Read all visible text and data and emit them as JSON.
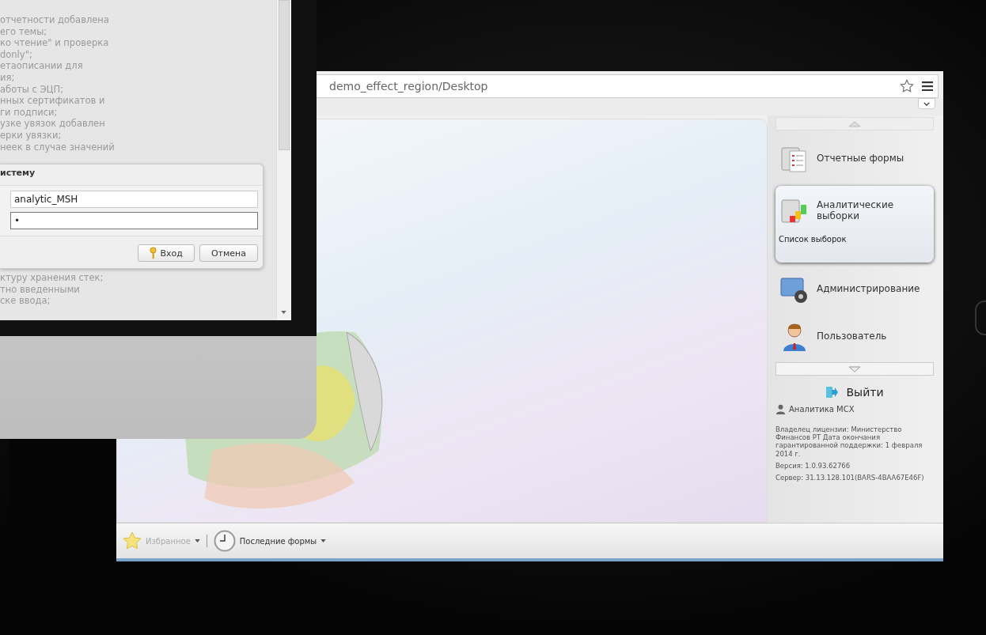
{
  "monitor": {
    "notes_before": [
      "отчетности добавлена",
      "его темы;",
      "ко чтение\" и проверка",
      "donly\";",
      "етаописании для",
      "ия;",
      "аботы с ЭЦП;",
      "нных сертификатов и",
      "ги подписи;",
      "узке увязок добавлен",
      "ерки увязки;",
      "неек в случае значений"
    ],
    "login": {
      "title": "истему",
      "username": "analytic_MSH",
      "password": "•",
      "buttons": [
        {
          "label": "Вход",
          "kind": "primary"
        },
        {
          "label": "Отмена",
          "kind": "plain"
        }
      ]
    },
    "notes_after": [
      "ктуру хранения стек;",
      "тно введенными",
      "ске ввода;"
    ]
  },
  "browser": {
    "url": "demo_effect_region/Desktop"
  },
  "sidebar": {
    "items": [
      {
        "label": "Отчетные формы",
        "selected": false
      },
      {
        "label": "Аналитические выборки",
        "selected": true,
        "sub": "Список выборок"
      },
      {
        "label": "Администрирование",
        "selected": false
      },
      {
        "label": "Пользователь",
        "selected": false
      }
    ],
    "logout": "Выйти",
    "user": "Аналитика МСХ",
    "info": [
      "Владелец лицензии: Министерство Финансов РТ Дата окончания гарантированной поддержки: 1 февраля 2014 г.",
      "Версия: 1.0.93.62766",
      "Сервер: 31.13.128.101(BARS-4BAA67E46F)"
    ]
  },
  "bottom_bar": {
    "items": [
      {
        "label": "Избранное",
        "disabled": true
      },
      {
        "label": "Последние формы",
        "disabled": false
      }
    ]
  }
}
